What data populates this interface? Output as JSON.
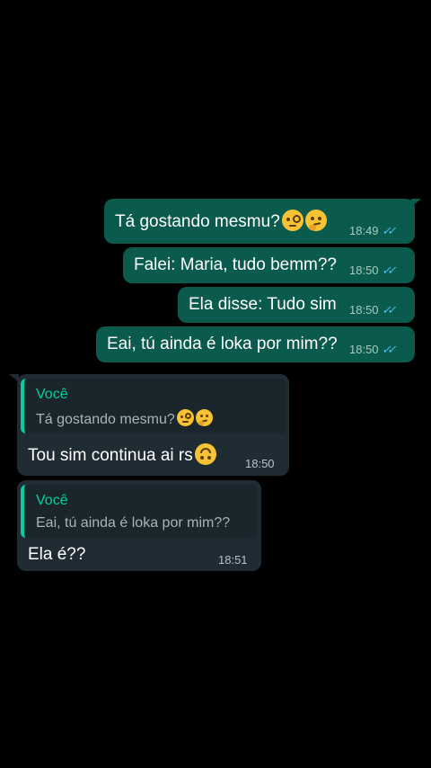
{
  "messages": {
    "m1": {
      "text": "Tá gostando mesmu?",
      "emoji": [
        "face-with-monocle-emoji",
        "thinking-face-emoji"
      ],
      "time": "18:49",
      "status": "read"
    },
    "m2": {
      "text": "Falei: Maria, tudo bemm??",
      "time": "18:50",
      "status": "read"
    },
    "m3": {
      "text": "Ela disse: Tudo sim",
      "time": "18:50",
      "status": "read"
    },
    "m4": {
      "text": "Eai, tú ainda é loka por mim??",
      "time": "18:50",
      "status": "read"
    },
    "m5": {
      "quote_author": "Você",
      "quote_text": "Tá gostando mesmu?",
      "quote_emoji": [
        "face-with-monocle-emoji",
        "thinking-face-emoji"
      ],
      "text": "Tou sim continua ai rs",
      "emoji": [
        "upside-down-face-emoji"
      ],
      "time": "18:50"
    },
    "m6": {
      "quote_author": "Você",
      "quote_text": "Eai, tú ainda é loka por mim??",
      "text": "Ela é??",
      "time": "18:51"
    }
  },
  "colors": {
    "background": "#000000",
    "outgoing_bubble": "#0a5b4d",
    "incoming_bubble": "#1f2c34",
    "quote_accent": "#06cf9c",
    "read_ticks": "#53bdeb"
  },
  "icons": {
    "read_receipt": "double-check-icon"
  }
}
